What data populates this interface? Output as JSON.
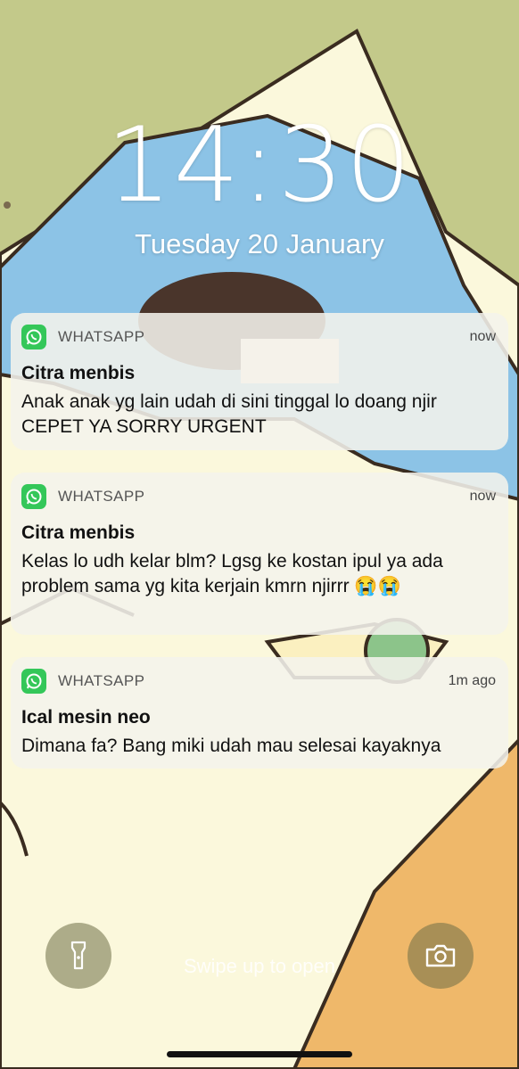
{
  "lockscreen": {
    "time": "14:30",
    "date": "Tuesday 20 January"
  },
  "notifications": [
    {
      "app": "WHATSAPP",
      "time": "now",
      "sender": "Citra menbis",
      "message": "Anak anak yg lain udah di sini tinggal lo doang njir CEPET YA SORRY URGENT"
    },
    {
      "app": "WHATSAPP",
      "time": "now",
      "sender": "Citra menbis",
      "message": "Kelas lo udh kelar blm? Lgsg ke kostan ipul ya ada problem sama yg kita kerjain kmrn njirrr 😭😭"
    },
    {
      "app": "WHATSAPP",
      "time": "1m ago",
      "sender": "Ical mesin neo",
      "message": "Dimana fa? Bang miki udah mau selesai kayaknya"
    }
  ],
  "bottom": {
    "swipe_label": "Swipe up to open",
    "flashlight_icon": "flashlight-icon",
    "camera_icon": "camera-icon"
  },
  "colors": {
    "whatsapp_green": "#34c759",
    "wallpaper_green": "#c3c98a",
    "wallpaper_cream": "#fbf8dc",
    "wallpaper_blue": "#8cc3e6",
    "wallpaper_orange": "#efb86a"
  }
}
